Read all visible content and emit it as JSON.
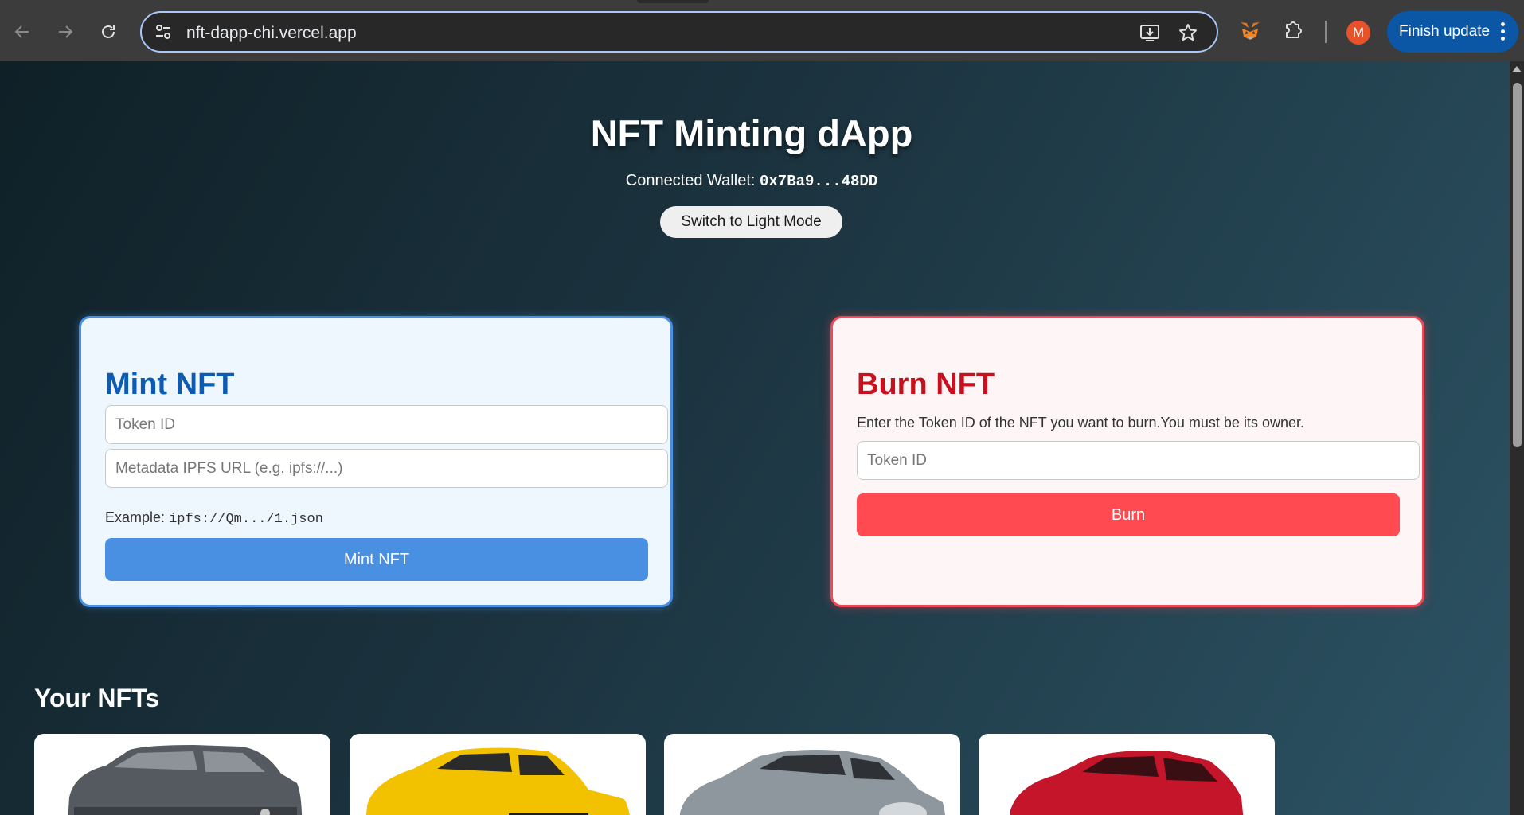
{
  "browser": {
    "url": "nft-dapp-chi.vercel.app",
    "finish_update_label": "Finish update",
    "avatar_letter": "M",
    "icons": [
      "back-icon",
      "forward-icon",
      "reload-icon",
      "site-info-icon",
      "install-app-icon",
      "bookmark-star-icon",
      "metamask-fox-icon",
      "extensions-puzzle-icon",
      "kebab-menu-icon"
    ]
  },
  "header": {
    "title": "NFT Minting dApp",
    "wallet_label": "Connected Wallet:",
    "wallet_address": "0x7Ba9...48DD",
    "theme_toggle_label": "Switch to Light Mode"
  },
  "mint": {
    "title": "Mint NFT",
    "token_id_placeholder": "Token ID",
    "metadata_placeholder": "Metadata IPFS URL (e.g. ipfs://...)",
    "example_label": "Example:",
    "example_value": "ipfs://Qm.../1.json",
    "button_label": "Mint NFT",
    "accent_color": "#4a90e2"
  },
  "burn": {
    "title": "Burn NFT",
    "description": "Enter the Token ID of the NFT you want to burn.You must be its owner.",
    "token_id_placeholder": "Token ID",
    "button_label": "Burn",
    "accent_color": "#ef4856"
  },
  "nfts": {
    "title": "Your NFTs",
    "items": [
      {
        "image": "grey-suv-car",
        "color": "#555a60"
      },
      {
        "image": "yellow-sports-suv-car",
        "color": "#f2c200"
      },
      {
        "image": "silver-sports-car",
        "color": "#8e979e"
      },
      {
        "image": "red-supercar",
        "color": "#c4152a"
      }
    ]
  }
}
